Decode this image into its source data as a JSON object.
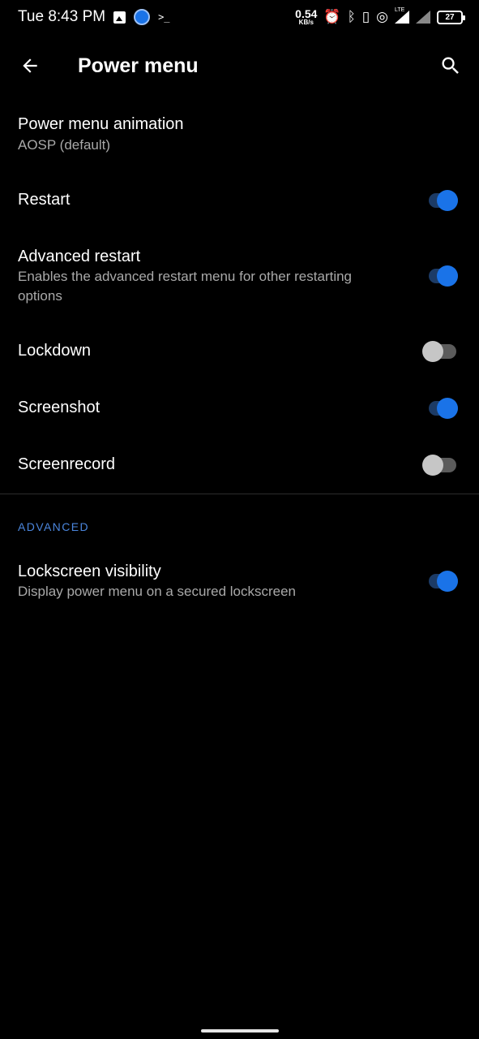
{
  "status_bar": {
    "time": "Tue 8:43 PM",
    "net_speed_value": "0.54",
    "net_speed_unit": "KB/s",
    "network_type": "LTE",
    "battery_level": "27",
    "icons": [
      "image-icon",
      "app-notification-icon",
      "terminal-icon",
      "alarm-icon",
      "bluetooth-icon",
      "vibrate-icon",
      "hotspot-icon",
      "signal-icon",
      "signal-no-data-icon",
      "battery-icon"
    ]
  },
  "app_bar": {
    "title": "Power menu",
    "back_icon": "arrow-back-icon",
    "search_icon": "search-icon"
  },
  "settings": {
    "animation": {
      "title": "Power menu animation",
      "summary": "AOSP (default)"
    },
    "restart": {
      "title": "Restart",
      "enabled": true
    },
    "advanced_restart": {
      "title": "Advanced restart",
      "summary_line1": "Enables the advanced restart menu for other restarting",
      "summary_line2": "options",
      "enabled": true
    },
    "lockdown": {
      "title": "Lockdown",
      "enabled": false
    },
    "screenshot": {
      "title": "Screenshot",
      "enabled": true
    },
    "screenrecord": {
      "title": "Screenrecord",
      "enabled": false
    }
  },
  "advanced_section": {
    "header": "ADVANCED",
    "lockscreen_visibility": {
      "title": "Lockscreen visibility",
      "summary": "Display power menu on a secured lockscreen",
      "enabled": true
    }
  },
  "colors": {
    "background": "#000000",
    "accent": "#1a73e8",
    "section_header": "#4b86dd",
    "secondary_text": "#a9a9a9"
  }
}
